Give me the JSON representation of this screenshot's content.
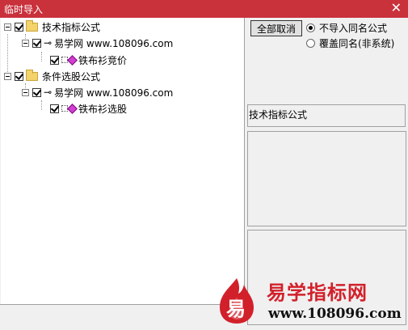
{
  "window": {
    "title": "临时导入",
    "close_glyph": "✕"
  },
  "tree": {
    "groups": [
      {
        "label": "技术指标公式",
        "source": "易学网 www.108096.com",
        "formula": "铁布衫竞价"
      },
      {
        "label": "条件选股公式",
        "source": "易学网 www.108096.com",
        "formula": "铁布衫选股"
      }
    ]
  },
  "actions": {
    "select_all_label": "全部取消"
  },
  "options": {
    "skip_label": "不导入同名公式",
    "overwrite_label": "覆盖同名(非系统)",
    "selected": "skip"
  },
  "info": {
    "category_label": "技术指标公式"
  },
  "watermark": {
    "logo_glyph": "易",
    "title": "易学指标网",
    "url": "www.108096.com"
  },
  "colors": {
    "title_bar": "#c9313b",
    "watermark_red": "#d2202a"
  }
}
